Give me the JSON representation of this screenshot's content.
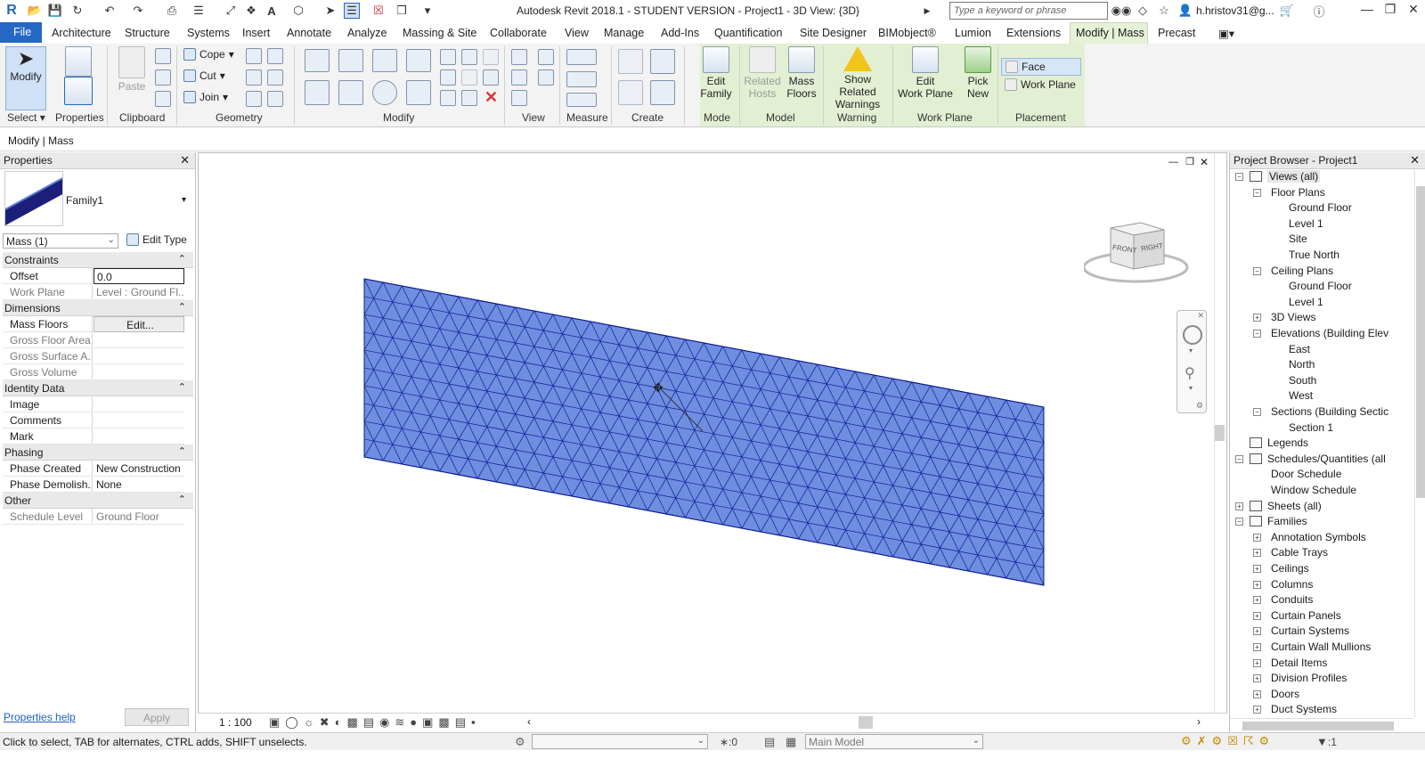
{
  "title_bar": {
    "title": "Autodesk Revit 2018.1 - STUDENT VERSION -    Project1 - 3D View: {3D}",
    "search_placeholder": "Type a keyword or phrase",
    "user": "h.hristov31@g...",
    "app_letter": "R"
  },
  "tabs": {
    "file": "File",
    "items": [
      "Architecture",
      "Structure",
      "Systems",
      "Insert",
      "Annotate",
      "Analyze",
      "Massing & Site",
      "Collaborate",
      "View",
      "Manage",
      "Add-Ins",
      "Quantification",
      "Site Designer",
      "BIMobject®",
      "Lumion",
      "Extensions"
    ],
    "active": "Modify | Mass",
    "after": "Precast"
  },
  "ribbon": {
    "modify": "Modify",
    "properties": "Properties",
    "paste": "Paste",
    "cope": "Cope",
    "cut": "Cut",
    "join": "Join",
    "edit_family": [
      "Edit",
      "Family"
    ],
    "related_hosts": [
      "Related",
      "Hosts"
    ],
    "mass_floors": [
      "Mass",
      "Floors"
    ],
    "show_related_warnings": [
      "Show Related",
      "Warnings"
    ],
    "edit_work_plane": [
      "Edit",
      "Work Plane"
    ],
    "pick_new": [
      "Pick",
      "New"
    ],
    "face": "Face",
    "work_plane": "Work Plane",
    "panels": [
      "Select",
      "Properties",
      "Clipboard",
      "Geometry",
      "Modify",
      "View",
      "Measure",
      "Create",
      "Mode",
      "Model",
      "Warning",
      "Work Plane",
      "Placement"
    ]
  },
  "options_bar": "Modify | Mass",
  "properties": {
    "title": "Properties",
    "family_name": "Family1",
    "selector": "Mass (1)",
    "edit_type": "Edit Type",
    "groups": {
      "constraints": "Constraints",
      "dimensions": "Dimensions",
      "identity": "Identity Data",
      "phasing": "Phasing",
      "other": "Other"
    },
    "rows": {
      "offset": [
        "Offset",
        "0.0"
      ],
      "work_plane": [
        "Work Plane",
        "Level : Ground Fl..."
      ],
      "mass_floors": [
        "Mass Floors",
        "Edit..."
      ],
      "gross_floor_area": [
        "Gross Floor Area",
        ""
      ],
      "gross_surface_area": [
        "Gross Surface A...",
        ""
      ],
      "gross_volume": [
        "Gross Volume",
        ""
      ],
      "image": [
        "Image",
        ""
      ],
      "comments": [
        "Comments",
        ""
      ],
      "mark": [
        "Mark",
        ""
      ],
      "phase_created": [
        "Phase Created",
        "New Construction"
      ],
      "phase_demolished": [
        "Phase Demolish...",
        "None"
      ],
      "schedule_level": [
        "Schedule Level",
        "Ground Floor"
      ]
    },
    "help": "Properties help",
    "apply": "Apply"
  },
  "view": {
    "scale": "1 : 100",
    "viewcube": [
      "FRONT",
      "RIGHT"
    ],
    "mass_color": "#6f8ee0",
    "grid_color": "#1a2a9c"
  },
  "browser": {
    "title": "Project Browser - Project1",
    "views_all": "Views (all)",
    "floor_plans": "Floor Plans",
    "fp_items": [
      "Ground Floor",
      "Level 1",
      "Site",
      "True North"
    ],
    "ceiling_plans": "Ceiling Plans",
    "cp_items": [
      "Ground Floor",
      "Level 1"
    ],
    "views_3d": "3D Views",
    "elevations": "Elevations (Building Elev",
    "el_items": [
      "East",
      "North",
      "South",
      "West"
    ],
    "sections": "Sections (Building Sectic",
    "sec_items": [
      "Section 1"
    ],
    "legends": "Legends",
    "schedules": "Schedules/Quantities (all",
    "sch_items": [
      "Door Schedule",
      "Window Schedule"
    ],
    "sheets": "Sheets (all)",
    "families": "Families",
    "fam_items": [
      "Annotation Symbols",
      "Cable Trays",
      "Ceilings",
      "Columns",
      "Conduits",
      "Curtain Panels",
      "Curtain Systems",
      "Curtain Wall Mullions",
      "Detail Items",
      "Division Profiles",
      "Doors",
      "Duct Systems"
    ]
  },
  "status": {
    "text": "Click to select, TAB for alternates, CTRL adds, SHIFT unselects.",
    "sel_count": ":0",
    "model": "Main Model",
    "filter": ":1"
  }
}
